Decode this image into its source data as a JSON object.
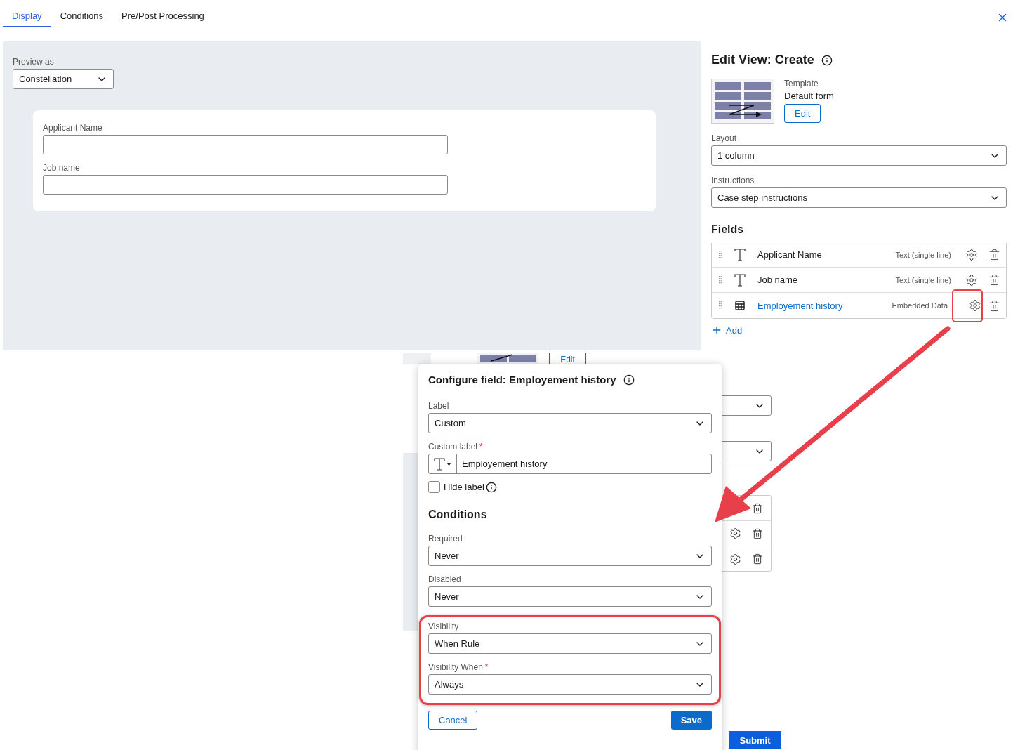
{
  "tabs": [
    {
      "label": "Display",
      "selected": true
    },
    {
      "label": "Conditions",
      "selected": false
    },
    {
      "label": "Pre/Post Processing",
      "selected": false
    }
  ],
  "preview": {
    "label": "Preview as",
    "value": "Constellation"
  },
  "form_preview": {
    "fields": [
      {
        "label": "Applicant Name"
      },
      {
        "label": "Job name"
      }
    ]
  },
  "edit_view": {
    "title": "Edit View: Create",
    "template_label": "Template",
    "template_value": "Default form",
    "edit_button": "Edit",
    "selects": [
      {
        "label": "Layout",
        "value": "1 column"
      },
      {
        "label": "Instructions",
        "value": "Case step instructions"
      }
    ],
    "fields_heading": "Fields",
    "fields": [
      {
        "kind": "text",
        "name": "Applicant Name",
        "type": "Text (single line)",
        "highlighted": false
      },
      {
        "kind": "text",
        "name": "Job name",
        "type": "Text (single line)",
        "highlighted": false
      },
      {
        "kind": "embedded",
        "name": "Employement history",
        "type": "Embedded Data",
        "highlighted": true
      }
    ],
    "add_label": "Add"
  },
  "background_screen": {
    "edit_button": "Edit",
    "submit_button": "Submit"
  },
  "configure_dialog": {
    "title": "Configure field: Employement history",
    "label_field": {
      "label": "Label",
      "value": "Custom"
    },
    "custom_label": {
      "label": "Custom label",
      "required": true,
      "value": "Employement history"
    },
    "hide_label": {
      "label": "Hide label",
      "checked": false
    },
    "conditions_heading": "Conditions",
    "required_mark": "*",
    "selects": [
      {
        "label": "Required",
        "value": "Never",
        "required": false,
        "highlighted": false
      },
      {
        "label": "Disabled",
        "value": "Never",
        "required": false,
        "highlighted": false
      },
      {
        "label": "Visibility",
        "value": "When Rule",
        "required": false,
        "highlighted": true
      },
      {
        "label": "Visibility When",
        "value": "Always",
        "required": true,
        "highlighted": true
      }
    ],
    "cancel_button": "Cancel",
    "save_button": "Save"
  }
}
